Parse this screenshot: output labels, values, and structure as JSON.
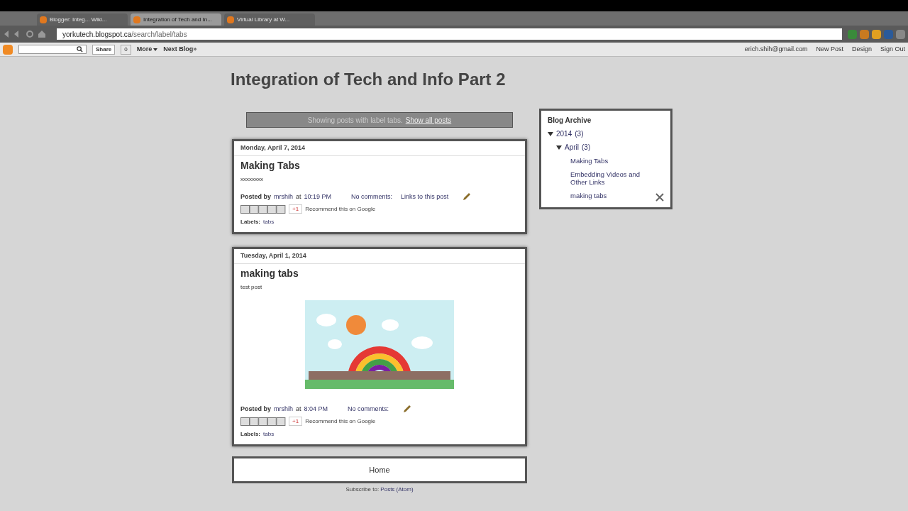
{
  "browser": {
    "tabs": [
      {
        "title": "Blogger: Integ... Wiki...",
        "selected": false
      },
      {
        "title": "Integration of Tech and In...",
        "selected": true
      },
      {
        "title": "Virtual Library at W...",
        "selected": false
      }
    ],
    "url": {
      "host": "yorkutech.blogspot.ca",
      "path": "/search/label/tabs"
    }
  },
  "navbar": {
    "share": "Share",
    "share_count": "0",
    "more": "More",
    "next_blog": "Next Blog»",
    "account": "erich.shih@gmail.com",
    "links": [
      "New Post",
      "Design",
      "Sign Out"
    ]
  },
  "blog": {
    "title": "Integration of Tech and Info Part 2",
    "status": {
      "text": "Showing posts with label tabs.",
      "link": "Show all posts"
    },
    "posts": [
      {
        "date": "Monday, April 7, 2014",
        "title": "Making Tabs",
        "body": "xxxxxxxx",
        "posted_by": "Posted by",
        "author": "mrshih",
        "at": "at",
        "time": "10:19 PM",
        "comments": "No comments:",
        "backlinks": "Links to this post",
        "gplus": "+1",
        "recommend": "Recommend this on Google",
        "labels_prefix": "Labels:",
        "labels": [
          "tabs"
        ]
      },
      {
        "date": "Tuesday, April 1, 2014",
        "title": "making tabs",
        "body": "test post",
        "picture": {
          "kind": "picture"
        },
        "posted_by": "Posted by",
        "author": "mrshih",
        "at": "at",
        "time": "8:04 PM",
        "comments": "No comments:",
        "gplus": "+1",
        "recommend": "Recommend this on Google",
        "labels_prefix": "Labels:",
        "labels": [
          "tabs"
        ]
      }
    ],
    "home": "Home",
    "subscribe": {
      "text": "Subscribe to:",
      "link": "Posts (Atom)"
    }
  },
  "sidebar": {
    "title": "Blog Archive",
    "tree": [
      {
        "label": "2014",
        "count": "(3)",
        "expanded": true,
        "children": [
          {
            "label": "April",
            "count": "(3)",
            "expanded": true,
            "children": [
              {
                "label": "Making Tabs"
              },
              {
                "label": "Embedding Videos and Other Links"
              },
              {
                "label": "making tabs"
              }
            ]
          }
        ]
      }
    ]
  }
}
